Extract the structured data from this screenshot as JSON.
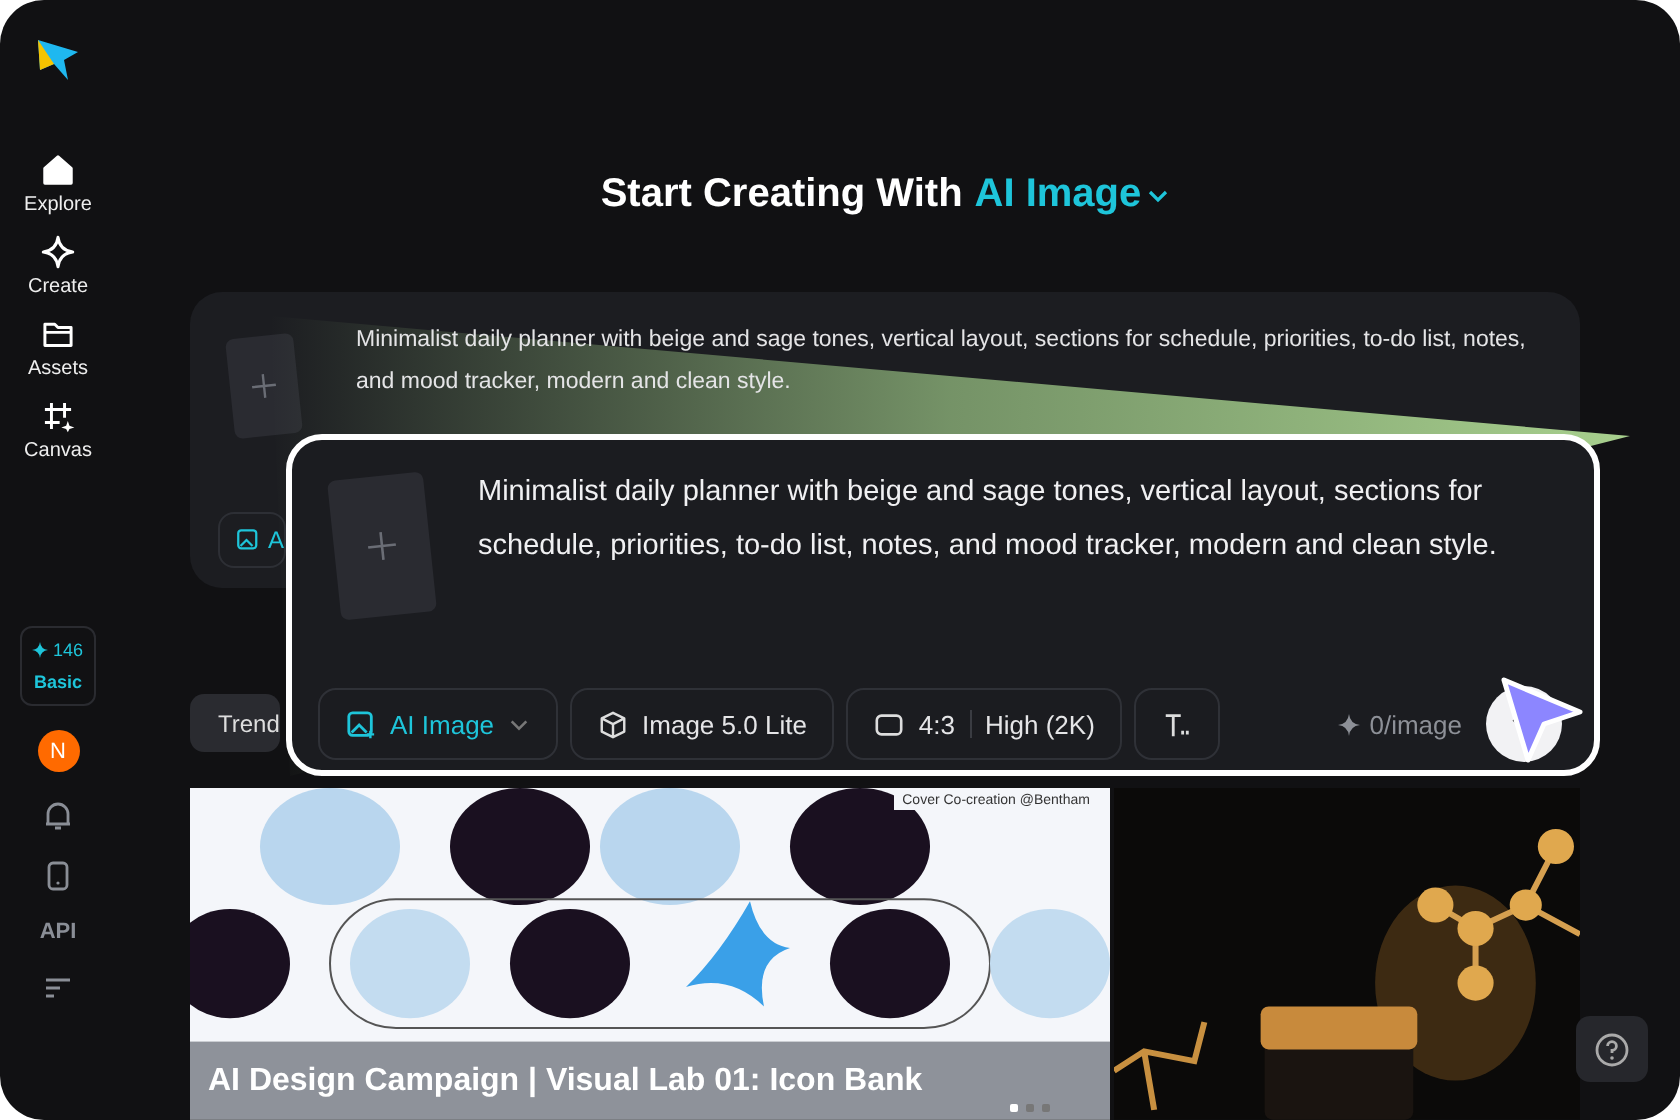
{
  "sidebar": {
    "items": [
      {
        "label": "Explore",
        "kind": "home"
      },
      {
        "label": "Create",
        "kind": "sparkle"
      },
      {
        "label": "Assets",
        "kind": "folder"
      },
      {
        "label": "Canvas",
        "kind": "crop"
      }
    ]
  },
  "credits": {
    "count": "146",
    "plan": "Basic"
  },
  "avatar": {
    "initial": "N"
  },
  "api_label": "API",
  "heading": {
    "text": "Start Creating With",
    "mode": "AI Image"
  },
  "background_prompt": {
    "text": "Minimalist daily planner with beige and sage tones, vertical layout, sections for schedule, priorities, to-do list, notes, and mood tracker, modern and clean style.",
    "chip": "A"
  },
  "callout": {
    "prompt": "Minimalist daily planner with beige and sage tones, vertical layout, sections for schedule, priorities, to-do list, notes, and mood tracker, modern and clean style.",
    "mode": "AI Image",
    "model": "Image 5.0 Lite",
    "ratio": "4:3",
    "quality": "High (2K)",
    "cost": "0/image"
  },
  "tabs": [
    {
      "label": "Trend",
      "selected": true
    }
  ],
  "feed": [
    {
      "kind": "picture",
      "caption": "Cover Co-creation @Bentham",
      "title": "AI Design Campaign | Visual Lab 01: Icon Bank"
    },
    {
      "kind": "picture"
    }
  ],
  "carousel": {
    "pages": [
      {
        "selected": true
      },
      {
        "selected": false
      },
      {
        "selected": false
      }
    ]
  }
}
